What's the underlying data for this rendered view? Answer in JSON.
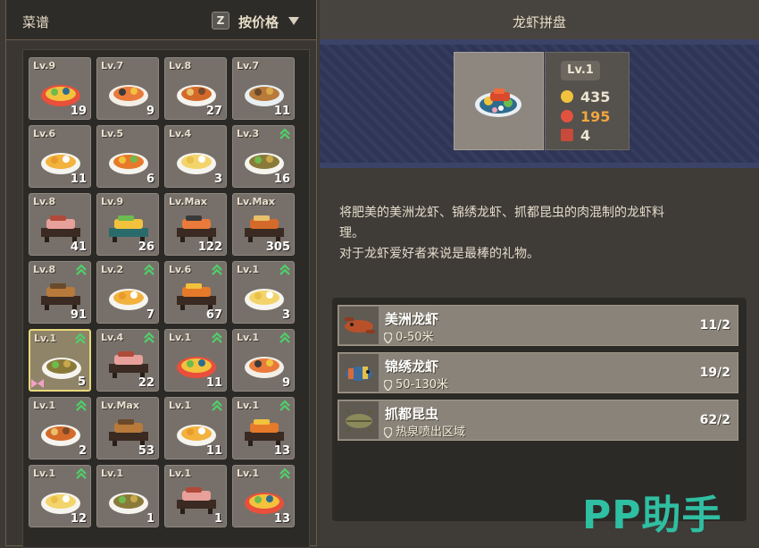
{
  "left_panel": {
    "title": "菜谱",
    "sort_key": "Z",
    "sort_label": "按价格"
  },
  "recipes": [
    {
      "level": "Lv.9",
      "count": "19",
      "upgrade": false,
      "selected": false,
      "dish": "platter-blue"
    },
    {
      "level": "Lv.7",
      "count": "9",
      "upgrade": false,
      "selected": false,
      "dish": "sushi-rolls"
    },
    {
      "level": "Lv.8",
      "count": "27",
      "upgrade": false,
      "selected": false,
      "dish": "noodle-bowl"
    },
    {
      "level": "Lv.7",
      "count": "11",
      "upgrade": false,
      "selected": false,
      "dish": "roast-plate"
    },
    {
      "level": "Lv.6",
      "count": "11",
      "upgrade": false,
      "selected": false,
      "dish": "egg-bowl"
    },
    {
      "level": "Lv.5",
      "count": "6",
      "upgrade": false,
      "selected": false,
      "dish": "curry-bowl"
    },
    {
      "level": "Lv.4",
      "count": "3",
      "upgrade": false,
      "selected": false,
      "dish": "tofu-plate"
    },
    {
      "level": "Lv.3",
      "count": "16",
      "upgrade": true,
      "selected": false,
      "dish": "soup-bowl"
    },
    {
      "level": "Lv.8",
      "count": "41",
      "upgrade": false,
      "selected": false,
      "dish": "sashimi-board"
    },
    {
      "level": "Lv.9",
      "count": "26",
      "upgrade": false,
      "selected": false,
      "dish": "sushi-board"
    },
    {
      "level": "Lv.Max",
      "count": "122",
      "upgrade": false,
      "selected": false,
      "dish": "fish-board"
    },
    {
      "level": "Lv.Max",
      "count": "305",
      "upgrade": false,
      "selected": false,
      "dish": "fish-board-dark"
    },
    {
      "level": "Lv.8",
      "count": "91",
      "upgrade": true,
      "selected": false,
      "dish": "salmon-board"
    },
    {
      "level": "Lv.2",
      "count": "7",
      "upgrade": true,
      "selected": false,
      "dish": "shrimp-plate"
    },
    {
      "level": "Lv.6",
      "count": "67",
      "upgrade": true,
      "selected": false,
      "dish": "fish-board-blue"
    },
    {
      "level": "Lv.1",
      "count": "3",
      "upgrade": true,
      "selected": false,
      "dish": "stew-bowl"
    },
    {
      "level": "Lv.1",
      "count": "5",
      "upgrade": true,
      "selected": true,
      "dish": "lobster-platter"
    },
    {
      "level": "Lv.4",
      "count": "22",
      "upgrade": true,
      "selected": false,
      "dish": "maki-board"
    },
    {
      "level": "Lv.1",
      "count": "11",
      "upgrade": true,
      "selected": false,
      "dish": "berry-plate"
    },
    {
      "level": "Lv.1",
      "count": "9",
      "upgrade": true,
      "selected": false,
      "dish": "crab-plate"
    },
    {
      "level": "Lv.1",
      "count": "2",
      "upgrade": true,
      "selected": false,
      "dish": "seafood-mix"
    },
    {
      "level": "Lv.Max",
      "count": "53",
      "upgrade": false,
      "selected": false,
      "dish": "fish-board-small"
    },
    {
      "level": "Lv.1",
      "count": "11",
      "upgrade": true,
      "selected": false,
      "dish": "rice-bowl"
    },
    {
      "level": "Lv.1",
      "count": "13",
      "upgrade": true,
      "selected": false,
      "dish": "nigiri-box"
    },
    {
      "level": "Lv.1",
      "count": "12",
      "upgrade": true,
      "selected": false,
      "dish": "ramen-bowl"
    },
    {
      "level": "Lv.1",
      "count": "1",
      "upgrade": false,
      "selected": false,
      "dish": "sushi-bowl"
    },
    {
      "level": "Lv.1",
      "count": "1",
      "upgrade": false,
      "selected": false,
      "dish": "shrimp-box"
    },
    {
      "level": "Lv.1",
      "count": "13",
      "upgrade": true,
      "selected": false,
      "dish": "salad-bowl"
    }
  ],
  "detail": {
    "title": "龙虾拼盘",
    "level": "Lv.1",
    "price": "435",
    "price_color": "#ece4d2",
    "rating": "195",
    "rating_color": "#f0a640",
    "portions": "4",
    "description": [
      "将肥美的美洲龙虾、锦绣龙虾、抓都昆虫的肉混制的龙虾料",
      "理。",
      "对于龙虾爱好者来说是最棒的礼物。"
    ]
  },
  "ingredients": [
    {
      "name": "美洲龙虾",
      "location": "0-50米",
      "quantity": "11/2",
      "icon": "lobster-icon"
    },
    {
      "name": "锦绣龙虾",
      "location": "50-130米",
      "quantity": "19/2",
      "icon": "painted-lobster-icon"
    },
    {
      "name": "抓都昆虫",
      "location": "热泉喷出区域",
      "quantity": "62/2",
      "icon": "isopod-icon"
    }
  ],
  "watermark": "PP助手",
  "colors": {
    "upgrade_green": "#4fd06a",
    "selected_border": "#e9d97c",
    "banner_blue": "#2f3557"
  }
}
